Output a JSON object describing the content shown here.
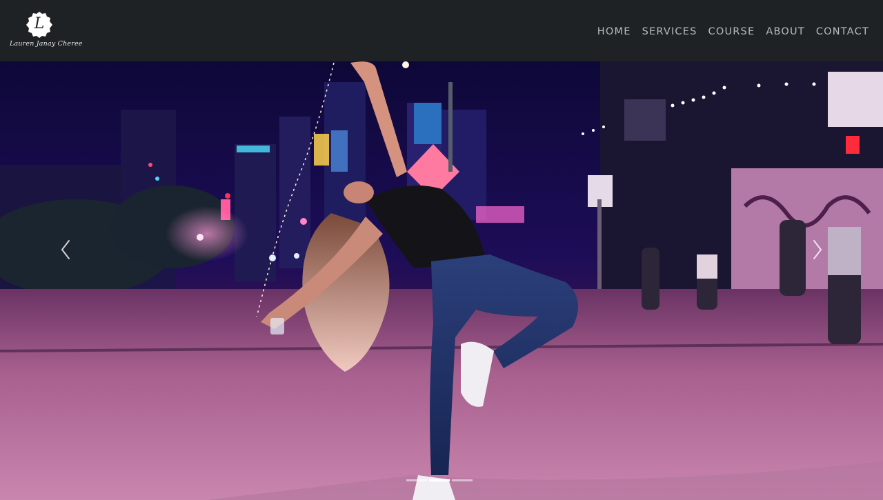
{
  "logo": {
    "letter": "L",
    "script_name": "Lauren Janay Cheree"
  },
  "nav": {
    "items": [
      "HOME",
      "SERVICES",
      "COURSE",
      "ABOUT",
      "CONTACT"
    ]
  },
  "carousel": {
    "prev_icon": "chevron-left-icon",
    "next_icon": "chevron-right-icon",
    "slide_count": 3,
    "active_slide": 1
  },
  "colors": {
    "navbar_bg": "#1f2225",
    "nav_text": "#b9bcbf",
    "hero_sky": "#150b4a",
    "hero_street": "#c07aa6"
  }
}
